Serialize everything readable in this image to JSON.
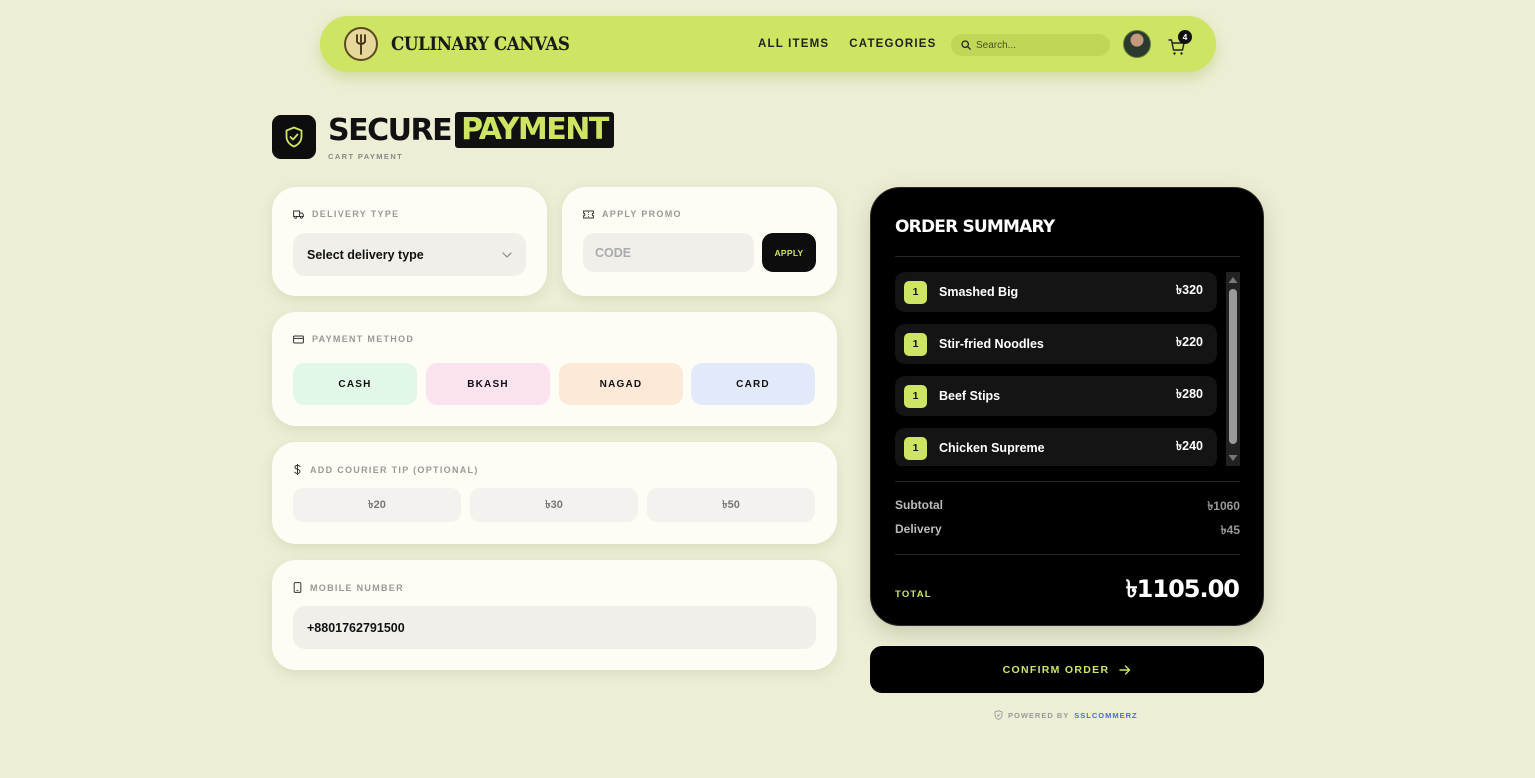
{
  "nav": {
    "brand": "CULINARY CANVAS",
    "links": [
      "ALL ITEMS",
      "CATEGORIES"
    ],
    "search_placeholder": "Search...",
    "cart_count": "4"
  },
  "header": {
    "title_main": "SECURE",
    "title_highlight": "PAYMENT",
    "subtitle": "CART PAYMENT"
  },
  "delivery": {
    "label": "DELIVERY TYPE",
    "selected": "Select delivery type"
  },
  "promo": {
    "label": "APPLY PROMO",
    "placeholder": "CODE",
    "button": "APPLY"
  },
  "payment": {
    "label": "PAYMENT METHOD",
    "methods": [
      {
        "label": "CASH",
        "color": "#e3f7e8"
      },
      {
        "label": "BKASH",
        "color": "#fbe2ef"
      },
      {
        "label": "NAGAD",
        "color": "#fde9d8"
      },
      {
        "label": "CARD",
        "color": "#e2e9fb"
      }
    ]
  },
  "tip": {
    "label": "ADD COURIER TIP (OPTIONAL)",
    "options": [
      "৳20",
      "৳30",
      "৳50"
    ]
  },
  "mobile": {
    "label": "MOBILE NUMBER",
    "value": "+8801762791500"
  },
  "summary": {
    "title": "ORDER SUMMARY",
    "items": [
      {
        "qty": "1",
        "name": "Smashed Big",
        "price": "৳320"
      },
      {
        "qty": "1",
        "name": "Stir-fried Noodles",
        "price": "৳220"
      },
      {
        "qty": "1",
        "name": "Beef Stips",
        "price": "৳280"
      },
      {
        "qty": "1",
        "name": "Chicken Supreme",
        "price": "৳240"
      }
    ],
    "subtotal_label": "Subtotal",
    "subtotal": "৳1060",
    "delivery_label": "Delivery",
    "delivery": "৳45",
    "total_label": "TOTAL",
    "total": "৳1105.00"
  },
  "confirm_button": "CONFIRM ORDER",
  "powered": {
    "prefix": "POWERED BY",
    "brand": "SSLCOMMERZ"
  },
  "colors": {
    "accent": "#cde562",
    "background": "#fafae8",
    "dark": "#000000"
  }
}
